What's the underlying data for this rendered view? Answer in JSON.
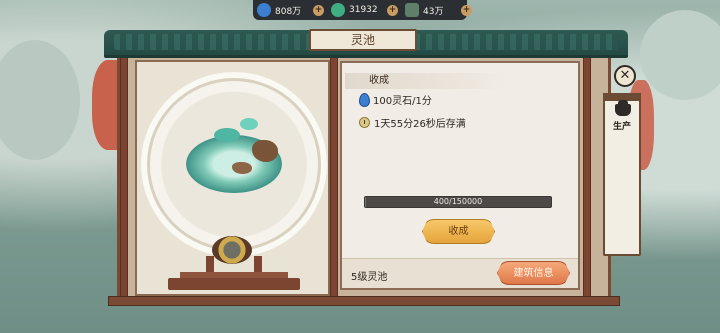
{
  "resources": [
    {
      "icon": "spirit-stone-icon",
      "value": "808万",
      "color": "#3c7fd1"
    },
    {
      "icon": "jade-icon",
      "value": "31932",
      "color": "#3fae83"
    },
    {
      "icon": "scroll-icon",
      "value": "43万",
      "color": "#5f7f6a"
    }
  ],
  "title": "灵池",
  "panel": {
    "section_title": "收成",
    "rate": "100灵石/1分",
    "time_to_full": "1天55分26秒后存满",
    "progress_text": "400/150000",
    "progress_fraction": 0.0027,
    "collect_button": "收成",
    "level_text": "5级灵池",
    "info_button": "建筑信息"
  },
  "side_tab": {
    "label": "生产",
    "icon": "pot-icon"
  },
  "close": {
    "icon": "close-icon"
  },
  "colors": {
    "roof": "#2d5a52",
    "frame": "#7a4a34",
    "collect_button": "#f0b54d",
    "info_button": "#ea8c5c"
  }
}
